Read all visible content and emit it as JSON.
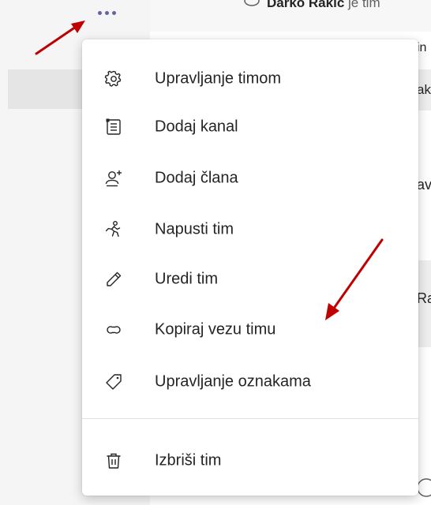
{
  "background": {
    "top_text_bold": "Darko Rakić",
    "top_text_rest": " je tim",
    "fragment_in": "in",
    "fragment_ak": "ak",
    "fragment_av": "av",
    "fragment_ra": "Ra"
  },
  "menu": {
    "items": [
      {
        "label": "Upravljanje timom",
        "icon": "gear-icon"
      },
      {
        "label": "Dodaj kanal",
        "icon": "channel-list-icon"
      },
      {
        "label": "Dodaj člana",
        "icon": "add-member-icon"
      },
      {
        "label": "Napusti tim",
        "icon": "leave-team-icon"
      },
      {
        "label": "Uredi tim",
        "icon": "pencil-icon"
      },
      {
        "label": "Kopiraj vezu timu",
        "icon": "link-icon"
      },
      {
        "label": "Upravljanje oznakama",
        "icon": "tag-icon"
      },
      {
        "label": "Izbriši tim",
        "icon": "trash-icon"
      }
    ]
  },
  "colors": {
    "accent": "#6264a7",
    "arrow": "#c00000"
  }
}
